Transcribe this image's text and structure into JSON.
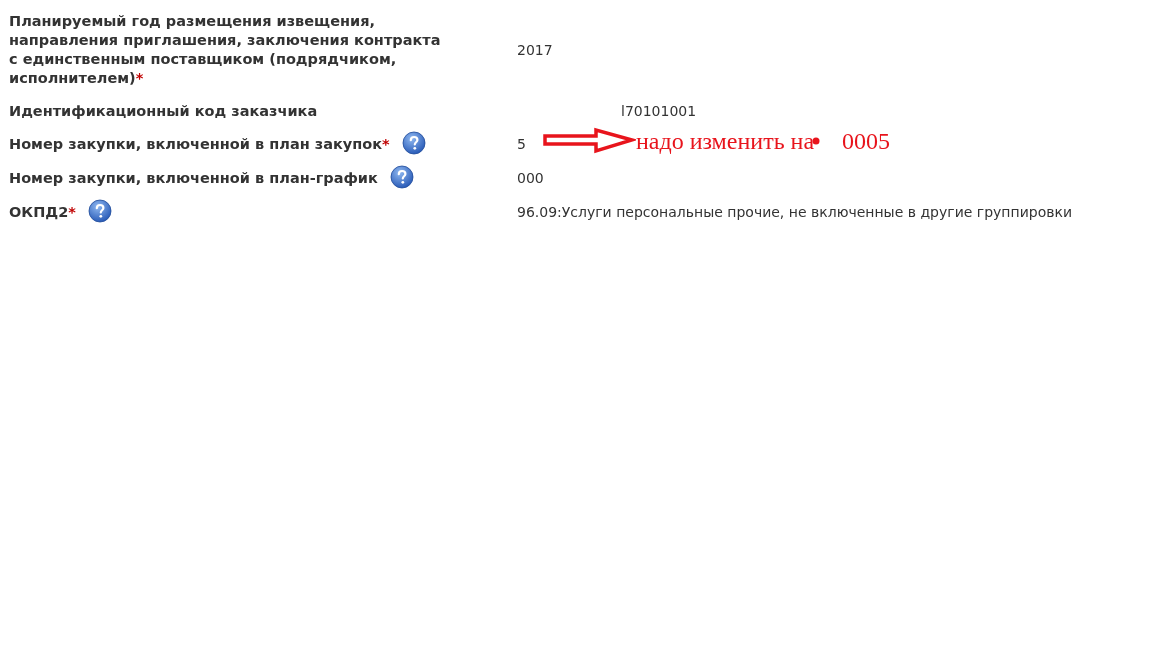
{
  "fields": [
    {
      "label": "Планируемый год размещения извещения, направления приглашения, заключения контракта с единственным поставщиком (подрядчиком, исполнителем)",
      "required_mark": "*",
      "help": false,
      "value": "2017",
      "kind": "plain"
    },
    {
      "label": "Идентификационный код заказчика",
      "help": false,
      "value": "l70101001",
      "kind": "masked"
    },
    {
      "label": "Номер закупки, включенной в план закупок",
      "required_mark": "*",
      "help": true,
      "value": "5",
      "kind": "plain",
      "annotation": {
        "text": "надо изменить на",
        "new_value": "0005"
      }
    },
    {
      "label": "Номер закупки, включенной в план-график",
      "help": true,
      "value": "000",
      "kind": "plain"
    },
    {
      "label": "ОКПД2",
      "required_mark": "*",
      "help": true,
      "value": "96.09:Услуги персональные прочие, не включенные в другие группировки",
      "kind": "plain"
    }
  ]
}
